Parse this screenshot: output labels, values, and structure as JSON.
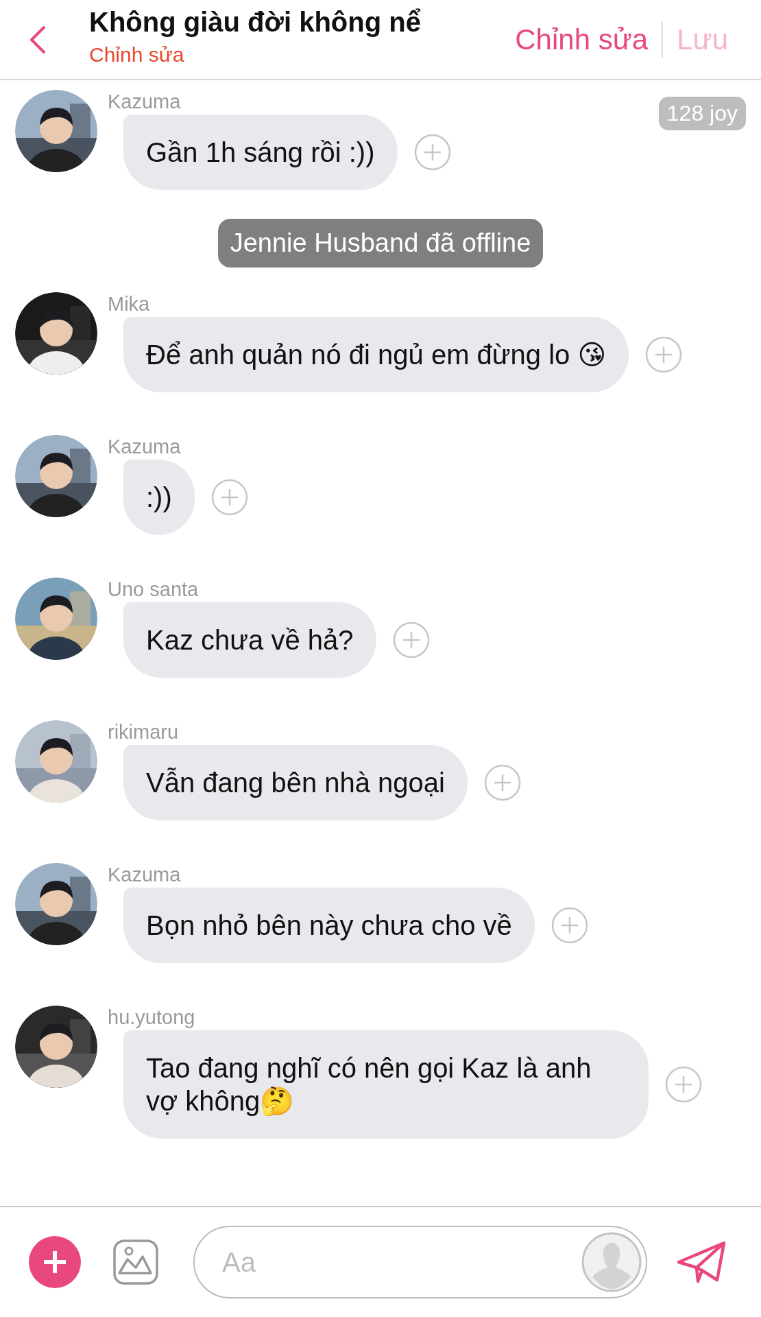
{
  "header": {
    "title": "Không giàu đời không nể",
    "subtitle": "Chỉnh sửa",
    "actions": [
      {
        "label": "Chỉnh sửa",
        "disabled": false
      },
      {
        "label": "Lưu",
        "disabled": true
      }
    ]
  },
  "badge": "128 joy",
  "messages": [
    {
      "kind": "message",
      "sender": "Kazuma",
      "text": "Gần 1h sáng rồi :))"
    },
    {
      "kind": "system",
      "text": "Jennie Husband đã offline"
    },
    {
      "kind": "message",
      "sender": "Mika",
      "text": "Để anh quản nó đi ngủ em đừng lo 😘"
    },
    {
      "kind": "message",
      "sender": "Kazuma",
      "text": ":))"
    },
    {
      "kind": "message",
      "sender": "Uno santa",
      "text": "Kaz chưa về hả?"
    },
    {
      "kind": "message",
      "sender": "rikimaru",
      "text": "Vẫn đang bên nhà ngoại"
    },
    {
      "kind": "message",
      "sender": "Kazuma",
      "text": "Bọn nhỏ bên này chưa cho về"
    },
    {
      "kind": "message",
      "sender": "hu.yutong",
      "text": "Tao đang nghĩ có nên gọi Kaz là anh vợ không🤔"
    }
  ],
  "composer": {
    "placeholder": "Aa"
  }
}
